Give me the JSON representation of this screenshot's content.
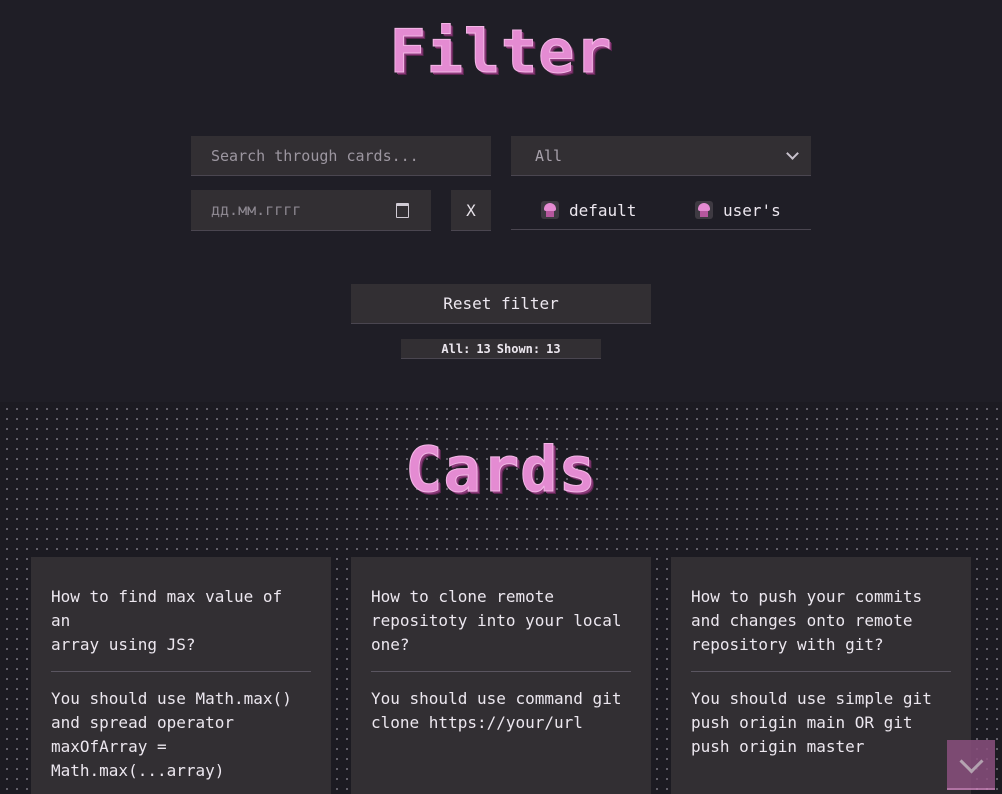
{
  "header": {
    "title": "Filter"
  },
  "filters": {
    "search": {
      "placeholder": "Search through cards...",
      "value": ""
    },
    "category": {
      "selected": "All"
    },
    "date": {
      "placeholder": "дд.мм.гггг"
    },
    "clear_label": "X",
    "source_options": [
      {
        "label": "default",
        "icon": "cupcake-icon"
      },
      {
        "label": "user's",
        "icon": "cupcake-icon"
      }
    ],
    "reset_label": "Reset filter",
    "counter": {
      "all_label": "All:",
      "all_value": "13",
      "shown_label": "Shown:",
      "shown_value": "13"
    }
  },
  "cards_section": {
    "title": "Cards",
    "cards": [
      {
        "question": "How to find max value of an\narray using JS?",
        "answer": "You should use Math.max()\nand spread operator\nmaxOfArray =\nMath.max(...array)"
      },
      {
        "question": "How to clone remote\nrepositoty into your local\none?",
        "answer": "You should use command git\nclone https://your/url"
      },
      {
        "question": "How to push your commits\nand changes onto remote\nrepository with git?",
        "answer": "You should use simple git\npush origin main OR git\npush origin master"
      }
    ]
  },
  "colors": {
    "accent": "#e48bd2",
    "background": "#1f1e26",
    "panel": "#322f33"
  }
}
